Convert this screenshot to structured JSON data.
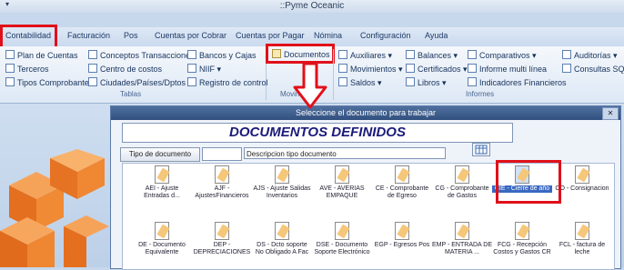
{
  "title_bar": {
    "quick_access": "▾",
    "title": "::Pyme Oceanic"
  },
  "menu": {
    "tabs": [
      "Contabilidad",
      "Facturación",
      "Pos",
      "Cuentas por Cobrar",
      "Cuentas por Pagar",
      "Nómina",
      "Configuración",
      "Ayuda"
    ]
  },
  "ribbon": {
    "tablas": {
      "items": [
        "Plan de Cuentas",
        "Terceros",
        "Tipos Comprobantes",
        "Conceptos Transacciones",
        "Centro de costos",
        "Ciudades/Países/Dptos",
        "Bancos y Cajas",
        "NIIF",
        "Registro de control"
      ],
      "label": "Tablas"
    },
    "movimiento": {
      "items": [
        "Documentos"
      ],
      "label": "Movimiento"
    },
    "informes": {
      "items": [
        "Auxiliares",
        "Movimientos",
        "Saldos",
        "Balances",
        "Certificados",
        "Libros",
        "Comparativos",
        "Informe multi línea",
        "Indicadores Financieros",
        "Auditorías",
        "Consultas SQL"
      ],
      "label": "Informes"
    }
  },
  "dialog": {
    "title": "Seleccione el documento para trabajar",
    "close": "✕",
    "heading": "DOCUMENTOS DEFINIDOS",
    "tipo_button": "Tipo de documento",
    "code_value": "",
    "desc_value": "Descripcion tipo documento",
    "documents": [
      "AEI - Ajuste Entradas d...",
      "AJF - AjustesFinancieros",
      "AJS - Ajuste Salidas Inventarios",
      "AVE - AVERIAS EMPAQUE",
      "CE - Comprobante de Egreso",
      "CG - Comprobante de Gastos",
      "CIE - Cierre de año",
      "CO - Consignacion",
      "DE - Documento Equivalente",
      "DEP - DEPRECIACIONES",
      "DS - Dcto soporte No Obligado A Fac",
      "DSE - Documento Soporte Electrónico",
      "EGP - Egresos Pos",
      "EMP - ENTRADA DE MATERIA ...",
      "FCG - Recepción Costos y Gastos CR",
      "FCL - factura de leche"
    ],
    "selected_document": "CIE - Cierre de año"
  },
  "colors": {
    "highlight": "#e0101a",
    "titlebar": "#3c5c8c"
  }
}
